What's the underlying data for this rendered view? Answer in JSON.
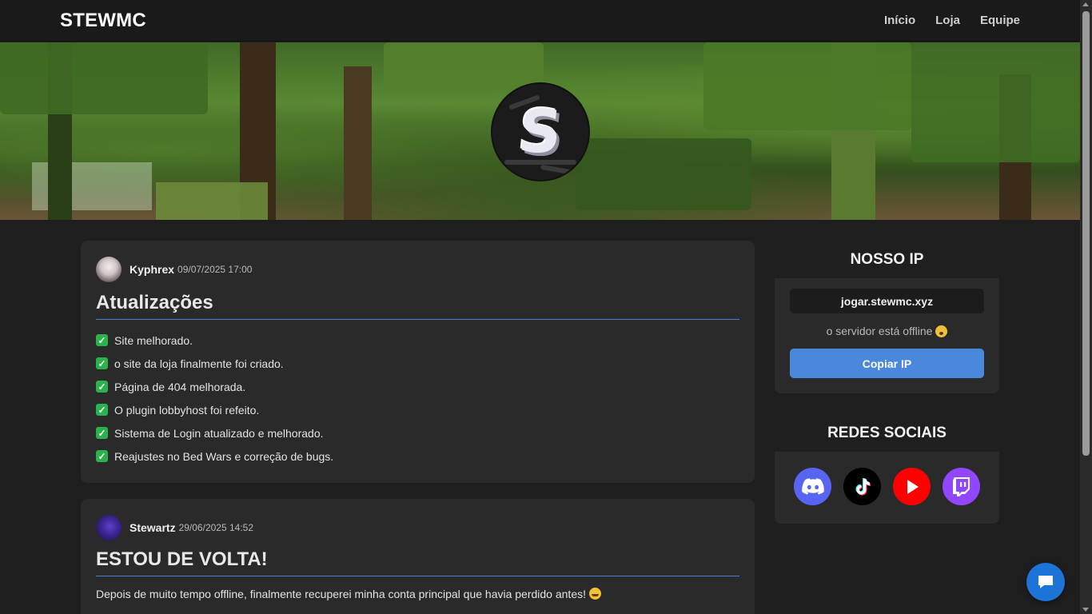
{
  "navbar": {
    "brand": "STEWMC",
    "links": [
      {
        "label": "Início"
      },
      {
        "label": "Loja"
      },
      {
        "label": "Equipe"
      }
    ]
  },
  "hero": {
    "logo_letter": "S"
  },
  "posts": [
    {
      "author": "Kyphrex",
      "date": "09/07/2025 17:00",
      "title": "Atualizações",
      "items": [
        "Site melhorado.",
        "o site da loja finalmente foi criado.",
        "Página de 404 melhorada.",
        "O plugin lobbyhost foi refeito.",
        "Sistema de Login atualizado e melhorado.",
        "Reajustes no Bed Wars e correção de bugs."
      ]
    },
    {
      "author": "Stewartz",
      "date": "29/06/2025 14:52",
      "title": "ESTOU DE VOLTA!",
      "body": "Depois de muito tempo offline, finalmente recuperei minha conta principal que havia perdido antes!"
    }
  ],
  "ip_card": {
    "title": "NOSSO IP",
    "ip": "jogar.stewmc.xyz",
    "status": "o servidor está offline",
    "copy_label": "Copiar IP"
  },
  "social_card": {
    "title": "REDES SOCIAIS",
    "icons": [
      "discord-icon",
      "tiktok-icon",
      "youtube-icon",
      "twitch-icon"
    ]
  },
  "colors": {
    "accent": "#4a88dc",
    "discord": "#5865f2",
    "youtube": "#ff0000",
    "twitch": "#9146ff",
    "tiktok": "#000000",
    "check": "#2bb24c"
  }
}
